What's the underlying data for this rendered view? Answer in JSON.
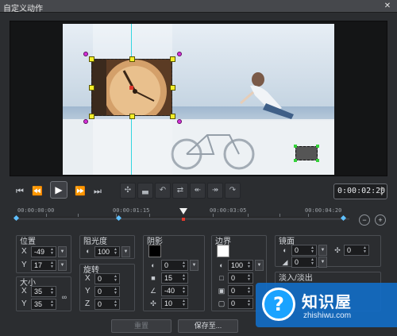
{
  "window": {
    "title": "自定义动作",
    "close_glyph": "✕"
  },
  "transport": {
    "buttons": {
      "first": "⏮",
      "prev": "⏪",
      "play": "▶",
      "next": "⏩",
      "last": "⏭"
    },
    "keyframe_tools": [
      "✣",
      "▃",
      "↶",
      "⇄",
      "↞",
      "↠",
      "↷"
    ],
    "timecode": "0:00:02:20"
  },
  "ruler": {
    "labels": [
      "00:00:00:00",
      "00:00:01:15",
      "00:00:03:05",
      "00:00:04:20"
    ],
    "zoom_out": "−",
    "zoom_in": "+"
  },
  "position": {
    "title": "位置",
    "x_label": "X",
    "x_value": "-49",
    "y_label": "Y",
    "y_value": "17"
  },
  "size": {
    "title": "大小",
    "x_label": "X",
    "x_value": "35",
    "y_label": "Y",
    "y_value": "35",
    "link_icon": "link-icon"
  },
  "opacity": {
    "title": "阻光度",
    "value": "100"
  },
  "rotation": {
    "title": "旋转",
    "x_label": "X",
    "x_value": "0",
    "y_label": "Y",
    "y_value": "0",
    "z_label": "Z",
    "z_value": "0"
  },
  "shadow": {
    "title": "阴影",
    "color": "#000000",
    "opacity_value": "0",
    "blur_value": "15",
    "angle_value": "-40",
    "distance_value": "10"
  },
  "border": {
    "title": "边界",
    "color": "#ffffff",
    "opacity_value": "100",
    "v1": "0",
    "v2": "0",
    "v3": "0"
  },
  "mirror": {
    "title": "镜面",
    "v1": "0",
    "v2": "0",
    "v3": "0",
    "fade_title": "淡入/淡出"
  },
  "footer": {
    "reset": "重置",
    "save": "保存至..."
  },
  "watermark": {
    "brand": "知识屋",
    "url": "zhishiwu.com",
    "logo_glyph": "?"
  }
}
